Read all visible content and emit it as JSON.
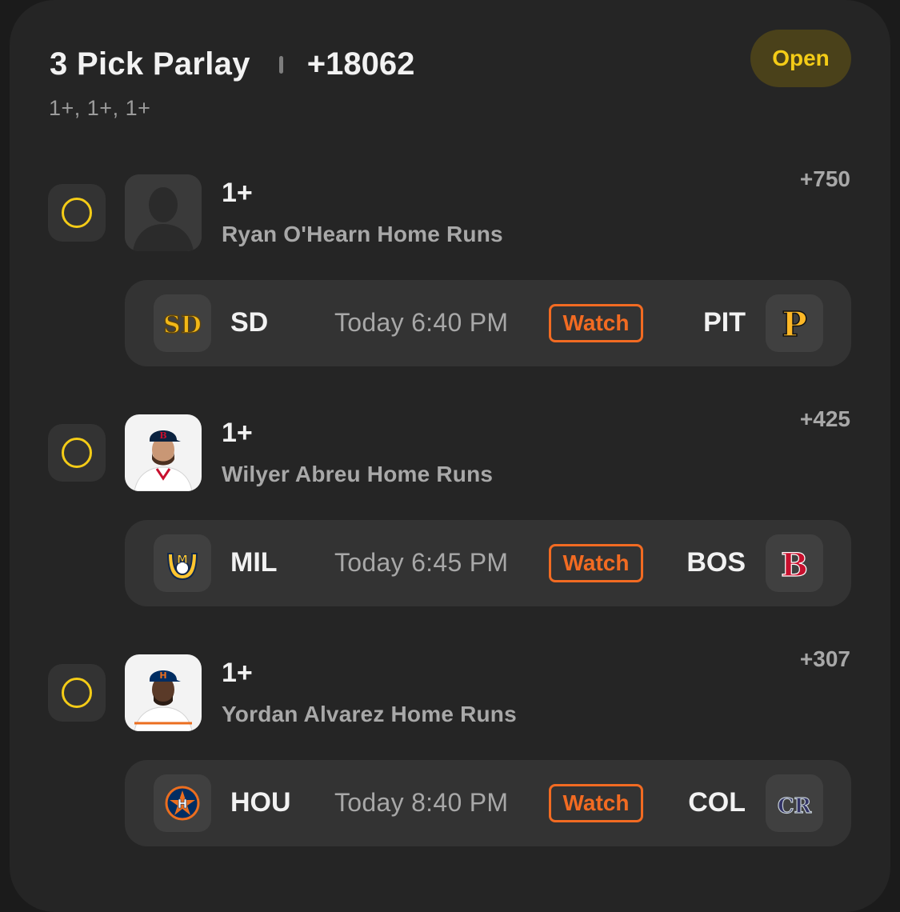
{
  "parlay": {
    "title": "3 Pick Parlay",
    "total_odds": "+18062",
    "summary": "1+, 1+, 1+",
    "status": "Open"
  },
  "legs": [
    {
      "line": "1+",
      "market": "Ryan O'Hearn Home Runs",
      "odds": "+750",
      "game": {
        "away": "SD",
        "time": "Today 6:40 PM",
        "watch": "Watch",
        "home": "PIT"
      }
    },
    {
      "line": "1+",
      "market": "Wilyer Abreu Home Runs",
      "odds": "+425",
      "game": {
        "away": "MIL",
        "time": "Today 6:45 PM",
        "watch": "Watch",
        "home": "BOS"
      }
    },
    {
      "line": "1+",
      "market": "Yordan Alvarez Home Runs",
      "odds": "+307",
      "game": {
        "away": "HOU",
        "time": "Today 8:40 PM",
        "watch": "Watch",
        "home": "COL"
      }
    }
  ],
  "logo_text": {
    "sd": "SD",
    "pit": "P",
    "mil": "M",
    "bos": "B",
    "hou": "H",
    "col": "CR"
  },
  "colors": {
    "accent_yellow": "#f4cc17",
    "watch_orange": "#f26b22",
    "card_bg": "#252525",
    "row_bg": "#333333"
  }
}
